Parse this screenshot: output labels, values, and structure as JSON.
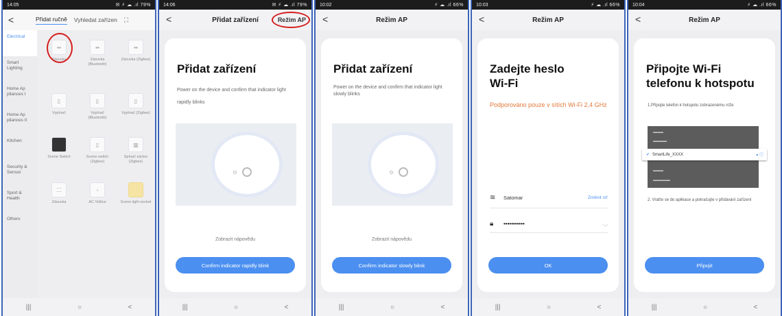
{
  "colors": {
    "accent": "#4b8ff0",
    "highlight_ring": "#d41d1d",
    "note_orange": "#e07838",
    "frame_border": "#3a63b8"
  },
  "phone1": {
    "status": {
      "time": "14:05",
      "icons": "✉ ⚡ ☁ .ıl 79%"
    },
    "tabs": {
      "manual": "Přidat ručně",
      "scan_tab": "Vyhledat zařízen"
    },
    "sidebar": [
      "Electrical",
      "Smart Lighting",
      "Home Ap pliances I",
      "Home Ap pliances II",
      "Kitchen",
      "Security & Sensor",
      "Sport & Health",
      "Others"
    ],
    "grid": [
      [
        "Zásuvka",
        "Zásuvka (Bluetooth)",
        "Zásuvka (Zigbee)"
      ],
      [
        "Vypínač",
        "Vypínač (Bluetooth)",
        "Vypínač (Zigbee)"
      ],
      [
        "Scene Switch",
        "Scene switch (Zigbee)",
        "Spínač záclon (Zigbee)"
      ],
      [
        "Zásuvka",
        "AC Vidlice",
        "Scene light socket"
      ]
    ]
  },
  "phone2": {
    "status": {
      "time": "14:06",
      "icons": "✉ ⚡ ☁ .ıl 79%"
    },
    "title": "Přidat zařízení",
    "right_link": "Režim AP",
    "heading": "Přidat zařízení",
    "desc": "Power on the device and confirm that indicator light rapidly blinks",
    "help": "Zobrazit nápovědu",
    "button": "Confirm indicator rapidly blink"
  },
  "phone3": {
    "status": {
      "time": "10:02",
      "icons": "⚡ ☁ .ıl 66%"
    },
    "title": "Režim AP",
    "heading": "Přidat zařízení",
    "desc": "Power on the device and confirm that indicator light slowly blinks",
    "help": "Zobrazit nápovědu",
    "button": "Confirm indicator slowly blink"
  },
  "phone4": {
    "status": {
      "time": "10:03",
      "icons": "⚡ ☁ .ıl 66%"
    },
    "title": "Režim AP",
    "heading": "Zadejte heslo Wi-Fi",
    "note": "Podporováno pouze v sítích Wi-Fi 2,4 GHz",
    "ssid": "Satomar",
    "change": "Změnit síť",
    "password": "•••••••••••",
    "button": "OK"
  },
  "phone5": {
    "status": {
      "time": "10:04",
      "icons": "⚡ ☁ .ıl 66%"
    },
    "title": "Režim AP",
    "heading": "Připojte Wi-Fi telefonu k hotspotu",
    "step1": "1.Připojte telefon k hotspotu zobrazenému níže",
    "ssid": "SmartLife_XXXX",
    "step2": "2. Vraťte se do aplikace a pokračujte v přidávání zařízení",
    "button": "Připojit"
  }
}
